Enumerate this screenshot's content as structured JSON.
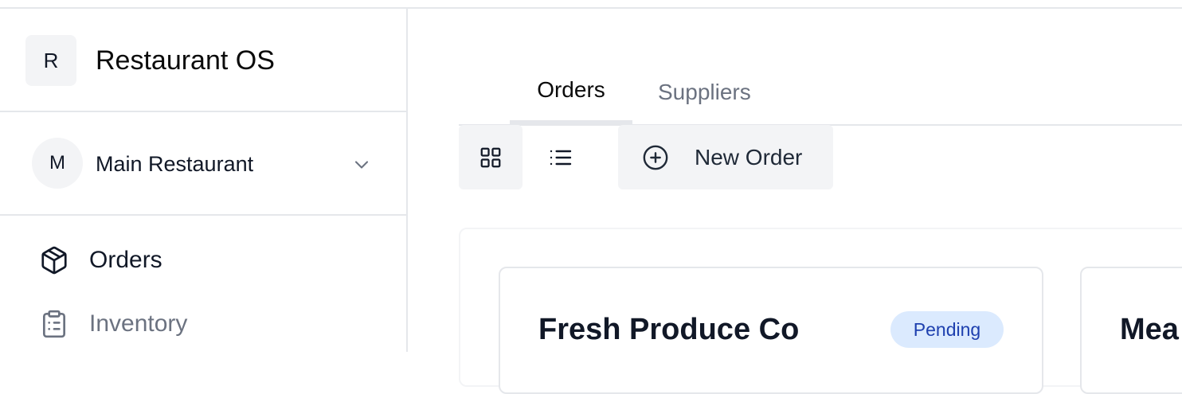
{
  "app": {
    "logo_letter": "R",
    "name": "Restaurant OS"
  },
  "restaurant": {
    "avatar_letter": "M",
    "name": "Main Restaurant",
    "chevron_icon": "chevron-down-icon"
  },
  "sidebar": {
    "items": [
      {
        "label": "Orders",
        "icon": "package-icon",
        "active": true
      },
      {
        "label": "Inventory",
        "icon": "clipboard-list-icon",
        "active": false
      }
    ]
  },
  "tabs": [
    {
      "label": "Orders",
      "active": true
    },
    {
      "label": "Suppliers",
      "active": false
    }
  ],
  "toolbar": {
    "grid_view_icon": "grid-icon",
    "list_view_icon": "list-icon",
    "new_order_label": "New Order",
    "new_order_icon": "plus-circle-icon"
  },
  "orders": [
    {
      "supplier": "Fresh Produce Co",
      "status": "Pending"
    },
    {
      "supplier": "Mea"
    }
  ],
  "colors": {
    "badge_bg": "#dbeafe",
    "badge_text": "#1e40af",
    "muted": "#6b7280",
    "surface": "#f3f4f6"
  }
}
